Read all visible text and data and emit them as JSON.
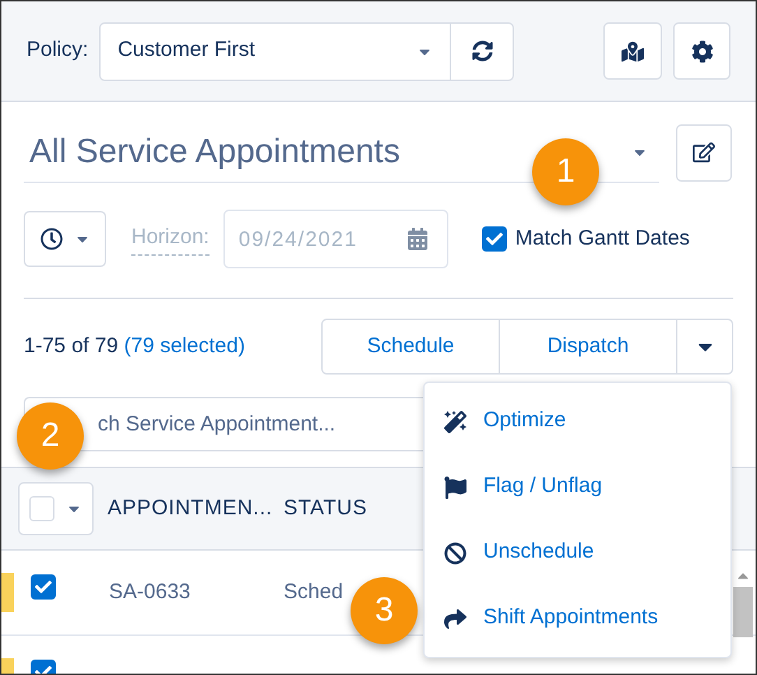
{
  "policy": {
    "label": "Policy:",
    "value": "Customer First"
  },
  "list_view": {
    "title": "All Service Appointments"
  },
  "horizon": {
    "label": "Horizon:",
    "placeholder": "09/24/2021"
  },
  "match_gantt": {
    "label": "Match Gantt Dates",
    "checked": true
  },
  "counts": {
    "range": "1-75 of 79",
    "selected": "(79 selected)"
  },
  "actions": [
    "Schedule",
    "Dispatch"
  ],
  "search": {
    "placeholder": "ch Service Appointment..."
  },
  "table": {
    "select_all": false,
    "columns": [
      "APPOINTMEN...",
      "STATUS"
    ],
    "rows": [
      {
        "checked": true,
        "color": "#f9d25b",
        "cells": [
          "SA-0633",
          "Sched"
        ]
      },
      {
        "checked": true,
        "color": "#f9d25b",
        "cells": []
      }
    ]
  },
  "menu": [
    {
      "kind": "wand",
      "label": "Optimize"
    },
    {
      "kind": "flag",
      "label": "Flag / Unflag"
    },
    {
      "kind": "ban",
      "label": "Unschedule"
    },
    {
      "kind": "share",
      "label": "Shift Appointments"
    }
  ],
  "callouts": [
    "1",
    "2",
    "3"
  ]
}
